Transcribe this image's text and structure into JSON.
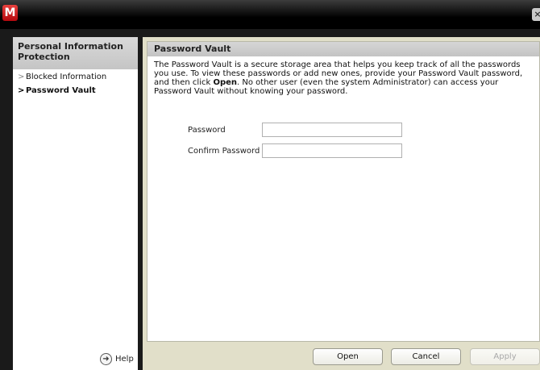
{
  "window": {
    "logo_letter": "M",
    "close_glyph": "×"
  },
  "sidebar": {
    "heading": "Personal Information Protection",
    "items": [
      {
        "label": "Blocked Information",
        "active": false
      },
      {
        "label": "Password Vault",
        "active": true
      }
    ],
    "help_label": "Help"
  },
  "panel": {
    "title": "Password Vault",
    "desc_part1": "The Password Vault is a secure storage area that helps you keep track of all the passwords you use. To view these passwords or add new ones, provide your Password Vault password, and then click ",
    "desc_bold": "Open",
    "desc_part2": ". No other user (even the system Administrator) can access your Password Vault without knowing your password.",
    "password_label": "Password",
    "password_value": "",
    "confirm_label": "Confirm Password",
    "confirm_value": ""
  },
  "buttons": {
    "open": "Open",
    "cancel": "Cancel",
    "apply": "Apply"
  },
  "icons": {
    "logo": "mcafee-logo-icon",
    "close": "close-icon",
    "nav_arrow": "chevron-right-icon",
    "help": "help-circle-arrow-icon"
  },
  "colors": {
    "logo_red": "#c8161d",
    "panel_bg": "#e1dfc9",
    "header_gray": "#c8c8c8"
  }
}
